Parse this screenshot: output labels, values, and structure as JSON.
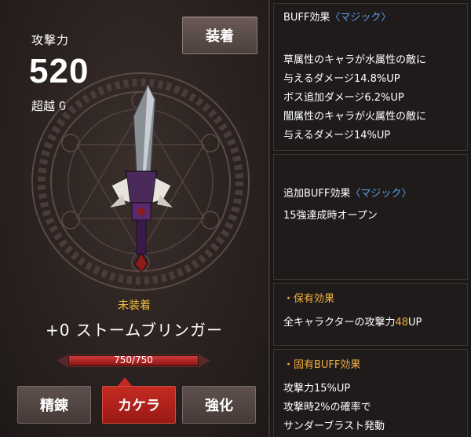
{
  "left": {
    "attack_label": "攻撃力",
    "attack_value": "520",
    "transcend_label": "超越 0",
    "equip_button": "装着",
    "status": "未装着",
    "weapon_name": "+0 ストームブリンガー",
    "durability": {
      "text": "750/750",
      "fraction": 1.0
    },
    "buttons": {
      "refine": "精錬",
      "kakera": "カケラ",
      "enhance": "強化"
    }
  },
  "right": {
    "buff": {
      "title": "BUFF効果",
      "sub": "〈マジック〉",
      "lines": [
        "草属性のキャラが水属性の敵に",
        "与えるダメージ14.8%UP",
        "ボス追加ダメージ6.2%UP",
        "闇属性のキャラが火属性の敵に",
        "与えるダメージ14%UP"
      ]
    },
    "extra_buff": {
      "title": "追加BUFF効果",
      "sub": "〈マジック〉",
      "line": "15強達成時オープン"
    },
    "owned": {
      "title": "・保有効果",
      "line_prefix": "全キャラクターの攻撃力",
      "line_value": "48",
      "line_suffix": "UP"
    },
    "unique": {
      "title": "・固有BUFF効果",
      "lines": [
        "攻撃力15%UP",
        "攻撃時2%の確率で",
        "サンダーブラスト発動"
      ]
    }
  },
  "colors": {
    "accent_gold": "#f0b040",
    "accent_blue": "#5aa0e8",
    "button_red": "#c42a22",
    "bar_red": "#d03a3a"
  }
}
